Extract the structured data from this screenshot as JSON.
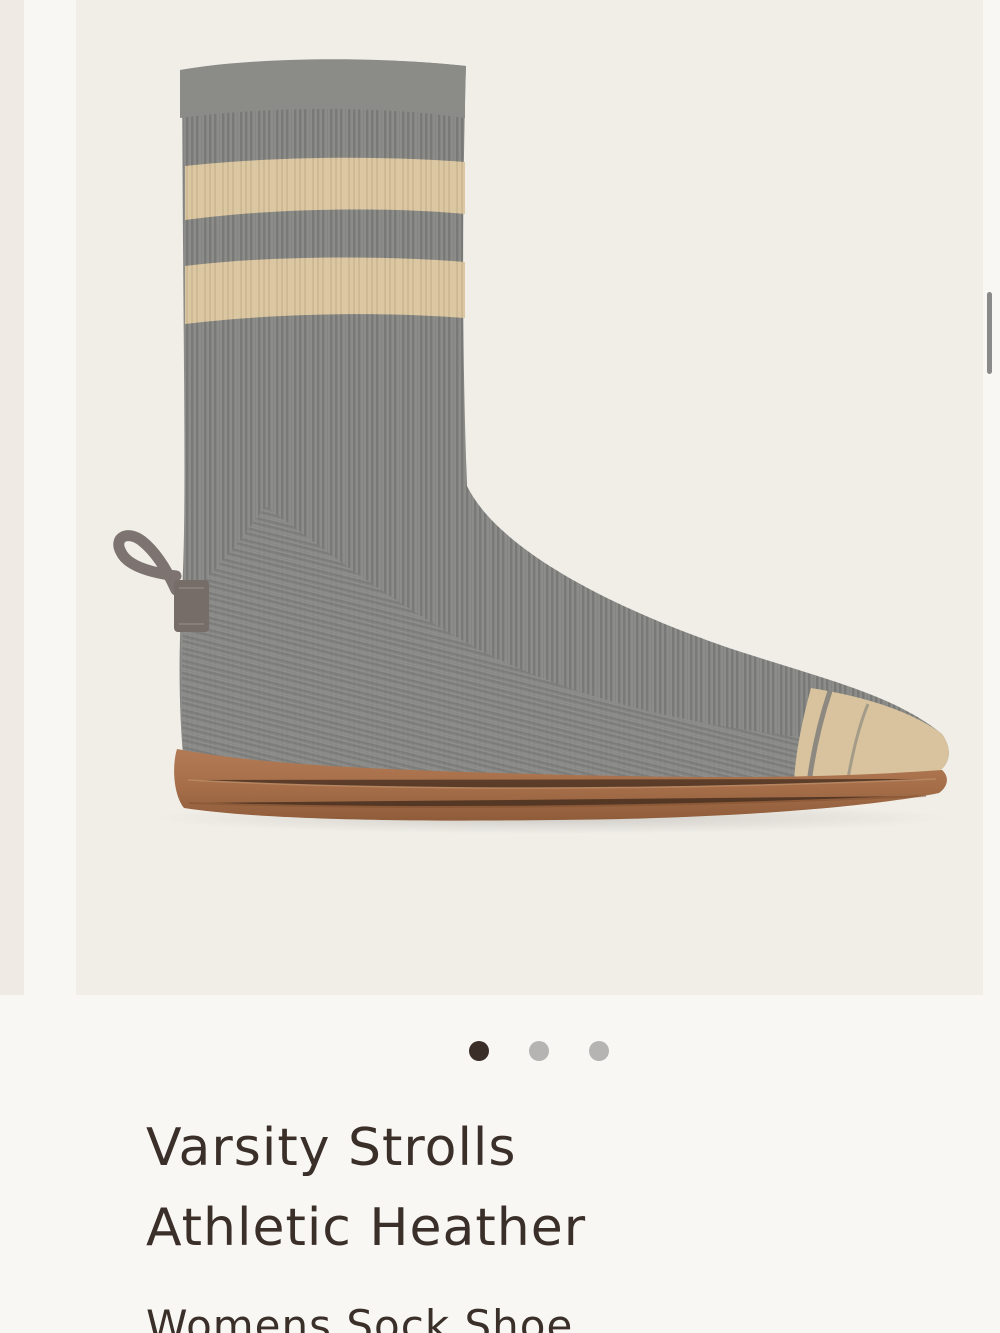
{
  "product": {
    "name_line1": "Varsity Strolls",
    "name_line2": "Athletic Heather",
    "category": "Womens Sock Shoe",
    "image_alt": "Varsity Strolls Athletic Heather sock shoe",
    "icon": "product-image"
  },
  "carousel": {
    "slide_count": 3,
    "active_index": 0
  },
  "colors": {
    "background": "#f8f7f4",
    "image_background": "#f1eee8",
    "heather_gray": "#858582",
    "stripe_tan": "#ddc9a4",
    "sole_brown": "#a8724d",
    "text": "#3b2f29",
    "active_dot": "#3a2e28",
    "inactive_dot": "#b5b4b2"
  },
  "scrollbar": {
    "visible": true
  }
}
